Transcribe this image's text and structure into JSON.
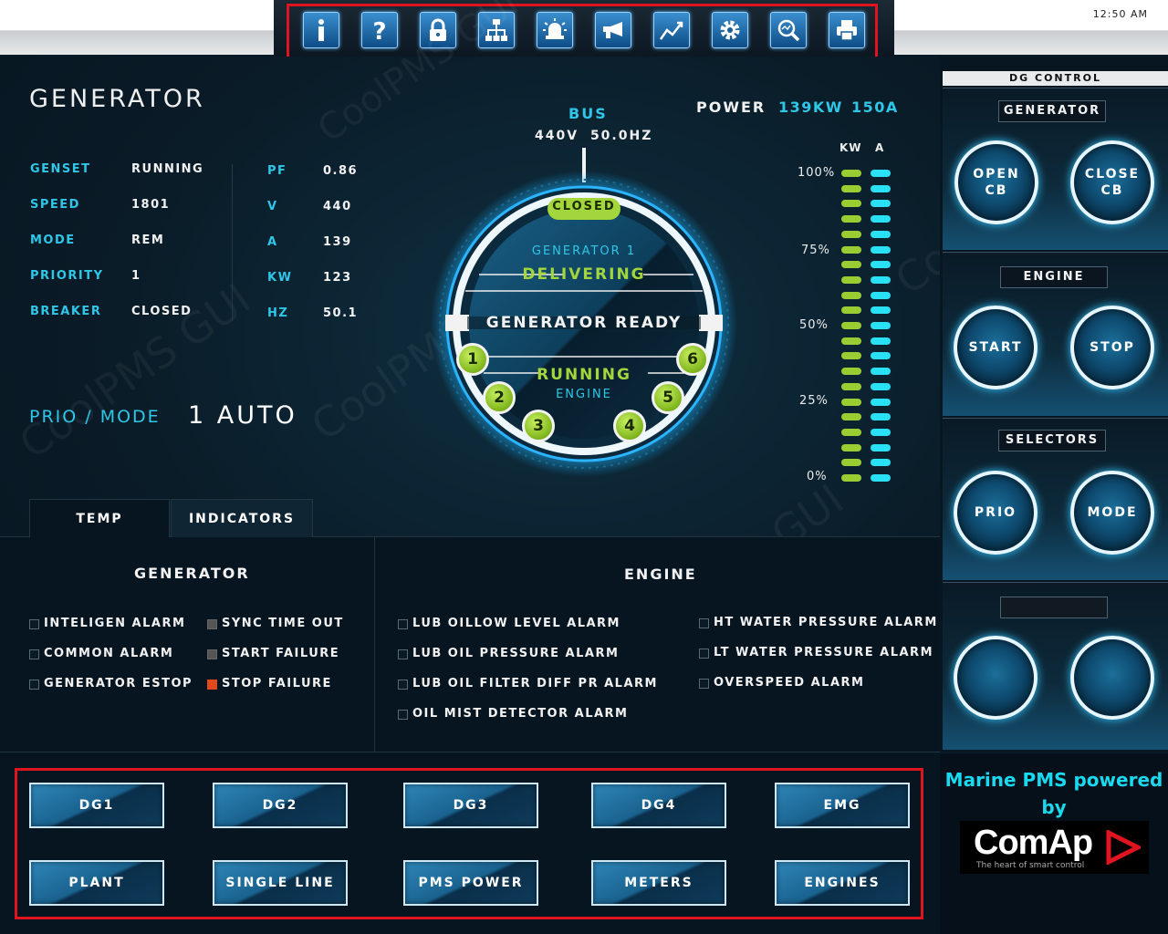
{
  "clock": "12:50 AM",
  "toolbar": {
    "icons": [
      "info-icon",
      "help-icon",
      "lock-icon",
      "hierarchy-icon",
      "alarm-bell-icon",
      "horn-icon",
      "trend-chart-icon",
      "gear-icon",
      "zoom-search-icon",
      "print-icon"
    ]
  },
  "generator": {
    "title": "GENERATOR",
    "rows_left": [
      {
        "label": "GENSET",
        "value": "RUNNING"
      },
      {
        "label": "SPEED",
        "value": "1801"
      },
      {
        "label": "MODE",
        "value": "REM"
      },
      {
        "label": "PRIORITY",
        "value": "1"
      },
      {
        "label": "BREAKER",
        "value": "CLOSED"
      }
    ],
    "rows_right": [
      {
        "label": "PF",
        "value": "0.86"
      },
      {
        "label": "V",
        "value": "440"
      },
      {
        "label": "A",
        "value": "139"
      },
      {
        "label": "KW",
        "value": "123"
      },
      {
        "label": "HZ",
        "value": "50.1"
      }
    ],
    "prio_mode_label": "PRIO / MODE",
    "prio_mode_value": "1 AUTO"
  },
  "bus": {
    "label": "BUS",
    "voltage": "440V",
    "frequency": "50.0HZ"
  },
  "dial": {
    "breaker": "CLOSED",
    "gen_name": "GENERATOR 1",
    "gen_state": "DELIVERING",
    "center": "GENERATOR READY",
    "engine_state": "RUNNING",
    "engine_label": "ENGINE",
    "steps": [
      "1",
      "2",
      "3",
      "4",
      "5",
      "6"
    ]
  },
  "power": {
    "label": "POWER",
    "kw": "139KW",
    "a": "150A",
    "col_kw": "KW",
    "col_a": "A",
    "scale": [
      "100%",
      "75%",
      "50%",
      "25%",
      "0%"
    ],
    "kw_level": 1.0,
    "a_level": 1.0
  },
  "tabs": {
    "temp": "TEMP",
    "indicators": "INDICATORS"
  },
  "indicators": {
    "generator_title": "GENERATOR",
    "engine_title": "ENGINE",
    "generator_col1": [
      "INTELIGEN  ALARM",
      "COMMON ALARM",
      "GENERATOR ESTOP"
    ],
    "generator_col2": [
      {
        "label": "SYNC TIME OUT",
        "state": "gray"
      },
      {
        "label": "START FAILURE",
        "state": "gray"
      },
      {
        "label": "STOP FAILURE",
        "state": "red"
      }
    ],
    "engine_col1": [
      "LUB OILLOW LEVEL ALARM",
      "LUB OIL PRESSURE ALARM",
      "LUB OIL FILTER DIFF PR ALARM",
      "OIL MIST DETECTOR ALARM"
    ],
    "engine_col2": [
      "HT WATER PRESSURE ALARM",
      "LT WATER PRESSURE ALARM",
      "OVERSPEED ALARM"
    ]
  },
  "nav": {
    "row1": [
      "DG1",
      "DG2",
      "DG3",
      "DG4",
      "EMG"
    ],
    "row2": [
      "PLANT",
      "SINGLE LINE",
      "PMS POWER",
      "METERS",
      "ENGINES"
    ]
  },
  "dg_control": {
    "header": "DG CONTROL",
    "generator_title": "GENERATOR",
    "open_cb": [
      "OPEN",
      "CB"
    ],
    "close_cb": [
      "CLOSE",
      "CB"
    ],
    "engine_title": "ENGINE",
    "start": "START",
    "stop": "STOP",
    "selectors_title": "SELECTORS",
    "prio": "PRIO",
    "mode": "MODE"
  },
  "brand": {
    "line1": "Marine PMS powered",
    "line2": "by",
    "logo": "ComAp",
    "tagline": "The heart of smart control"
  },
  "watermark": "CoolPMS GUI",
  "watermark_url": "www.coolpms.com"
}
